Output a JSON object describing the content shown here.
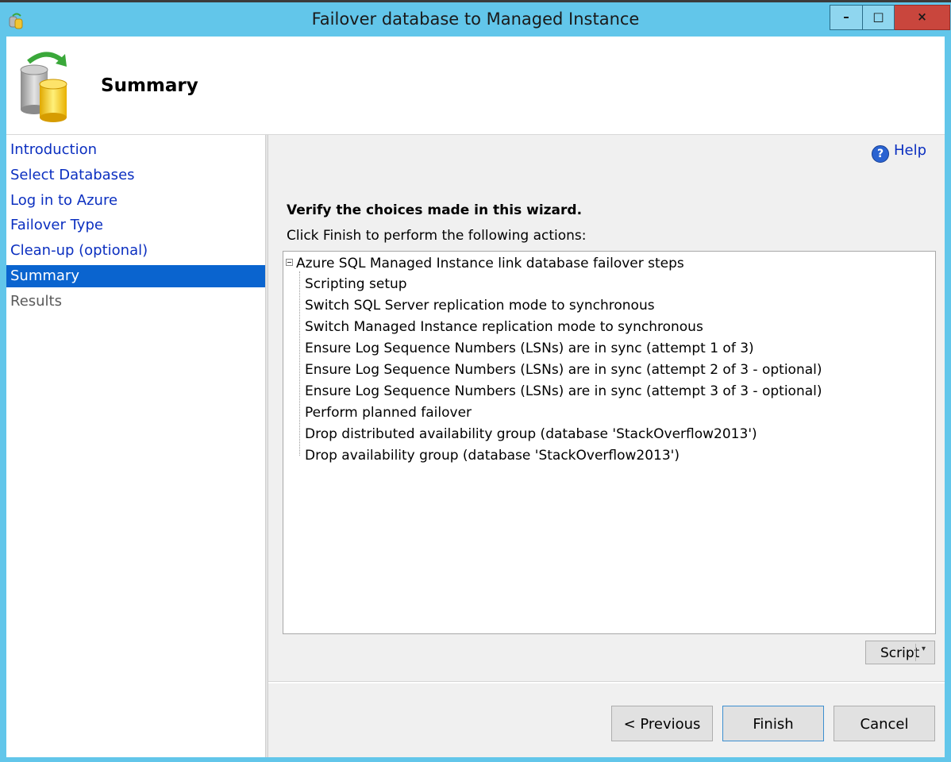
{
  "window": {
    "title": "Failover database to Managed Instance",
    "controls": {
      "minimize": "–",
      "maximize": "□",
      "close": "×"
    }
  },
  "header": {
    "page_title": "Summary",
    "icon": "database-failover-icon"
  },
  "sidebar": {
    "items": [
      {
        "label": "Introduction",
        "state": "link"
      },
      {
        "label": "Select Databases",
        "state": "link"
      },
      {
        "label": "Log in to Azure",
        "state": "link"
      },
      {
        "label": "Failover Type",
        "state": "link"
      },
      {
        "label": "Clean-up (optional)",
        "state": "link"
      },
      {
        "label": "Summary",
        "state": "selected"
      },
      {
        "label": "Results",
        "state": "disabled"
      }
    ]
  },
  "main": {
    "help_label": "Help",
    "verify_heading": "Verify the choices made in this wizard.",
    "instructions": "Click Finish to perform the following actions:",
    "tree": {
      "root": "Azure SQL Managed Instance link database failover steps",
      "children": [
        "Scripting setup",
        "Switch SQL Server replication mode to synchronous",
        "Switch Managed Instance replication mode to synchronous",
        "Ensure Log Sequence Numbers (LSNs) are in sync (attempt 1 of 3)",
        "Ensure Log Sequence Numbers (LSNs) are in sync (attempt 2 of 3 - optional)",
        "Ensure Log Sequence Numbers (LSNs) are in sync (attempt 3 of 3 - optional)",
        "Perform planned failover",
        "Drop distributed availability group (database 'StackOverflow2013')",
        "Drop availability group (database 'StackOverflow2013')"
      ]
    },
    "script_button": "Script"
  },
  "footer": {
    "previous": "< Previous",
    "finish": "Finish",
    "cancel": "Cancel"
  },
  "colors": {
    "title_bar": "#62c6ea",
    "selected_nav": "#0a64cf",
    "link": "#0b2fc0",
    "close_button": "#c9463d"
  }
}
